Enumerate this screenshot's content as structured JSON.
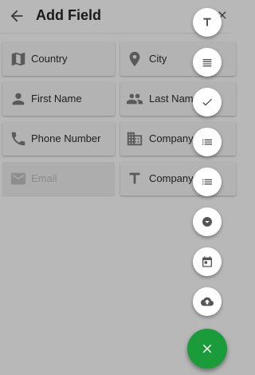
{
  "header": {
    "title": "Add Field",
    "back_icon": "arrow-back-icon",
    "close_icon": "close-icon"
  },
  "fields": [
    {
      "label": "Country",
      "icon": "map-icon",
      "enabled": true
    },
    {
      "label": "City",
      "icon": "location-pin-icon",
      "enabled": true
    },
    {
      "label": "First Name",
      "icon": "person-icon",
      "enabled": true
    },
    {
      "label": "Last Name",
      "icon": "people-icon",
      "enabled": true
    },
    {
      "label": "Phone Number",
      "icon": "phone-icon",
      "enabled": true
    },
    {
      "label": "Company",
      "icon": "business-icon",
      "enabled": true
    },
    {
      "label": "Email",
      "icon": "email-icon",
      "enabled": false
    },
    {
      "label": "Company",
      "icon": "text-format-icon",
      "enabled": true
    }
  ],
  "fab_menu": [
    {
      "icon": "text-icon"
    },
    {
      "icon": "paragraph-icon"
    },
    {
      "icon": "checkmark-icon"
    },
    {
      "icon": "list-icon"
    },
    {
      "icon": "list-icon"
    },
    {
      "icon": "dropdown-icon"
    },
    {
      "icon": "calendar-icon"
    },
    {
      "icon": "cloud-upload-icon"
    }
  ],
  "fab_main": {
    "icon": "close-icon",
    "color": "#1a9c3a"
  },
  "colors": {
    "overlay_background": "#b8b8b8",
    "icon_gray": "#5a5a5a",
    "disabled_text": "#8a8a8a"
  }
}
